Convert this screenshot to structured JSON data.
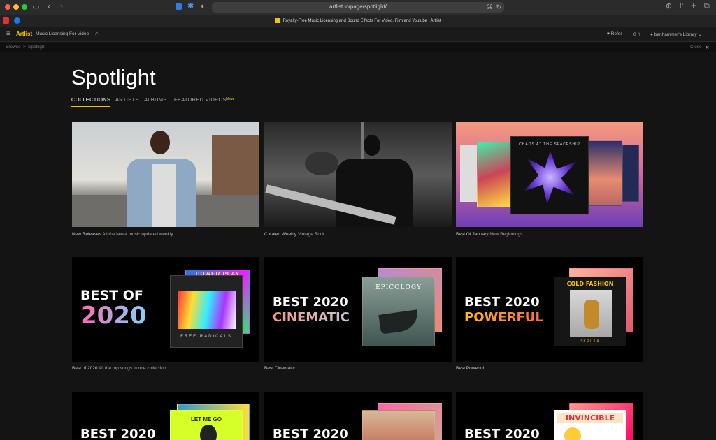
{
  "browser": {
    "url": "artlist.io/page/spotlight/",
    "tab_title": "Royalty-Free Music Licensing and Sound Effects For Video, Film and Youtube | Artlist"
  },
  "appbar": {
    "logo": "Artlist",
    "subtitle": "Music Licensing For Video",
    "refer": "Refer",
    "cart": "0",
    "library": "benhammer's Library"
  },
  "breadcrumb": {
    "root": "Browse",
    "sep": ">",
    "current": "Spotlight",
    "close": "Close"
  },
  "page": {
    "title": "Spotlight",
    "tabs": [
      "COLLECTIONS",
      "ARTISTS",
      "ALBUMS",
      "FEATURED VIDEOS"
    ],
    "new_badge": "New"
  },
  "cards": [
    {
      "title": "New Releases",
      "subtitle": "All the latest music updated weekly"
    },
    {
      "title": "Curated Weekly",
      "subtitle": "Vintage Rock"
    },
    {
      "title": "Best Of January",
      "subtitle": "New Beginnings",
      "cover_title": "CHAOS AT THE SPACESHIP"
    },
    {
      "title": "Best of 2020",
      "subtitle": "All the top songs in one collection",
      "art_line1": "BEST OF",
      "art_line2": "2020",
      "cover_title": "FREE RADICALS",
      "back_cover": "POWER PLAY"
    },
    {
      "title": "Best Cinematic",
      "art_line1": "BEST 2020",
      "art_line2": "CINEMATIC",
      "cover_title": "EPICOLOGY"
    },
    {
      "title": "Best Powerful",
      "art_line1": "BEST 2020",
      "art_line2": "POWERFUL",
      "cover_title": "COLD FASHION",
      "cover_artist": "SKRILLA"
    },
    {
      "art_line1": "BEST 2020",
      "cover_title": "LET ME GO"
    },
    {
      "art_line1": "BEST 2020"
    },
    {
      "art_line1": "BEST 2020",
      "cover_title": "INVINCIBLE"
    }
  ],
  "colors": {
    "accent": "#f5c400",
    "background": "#141414",
    "tab_underline": "#f5c400"
  }
}
